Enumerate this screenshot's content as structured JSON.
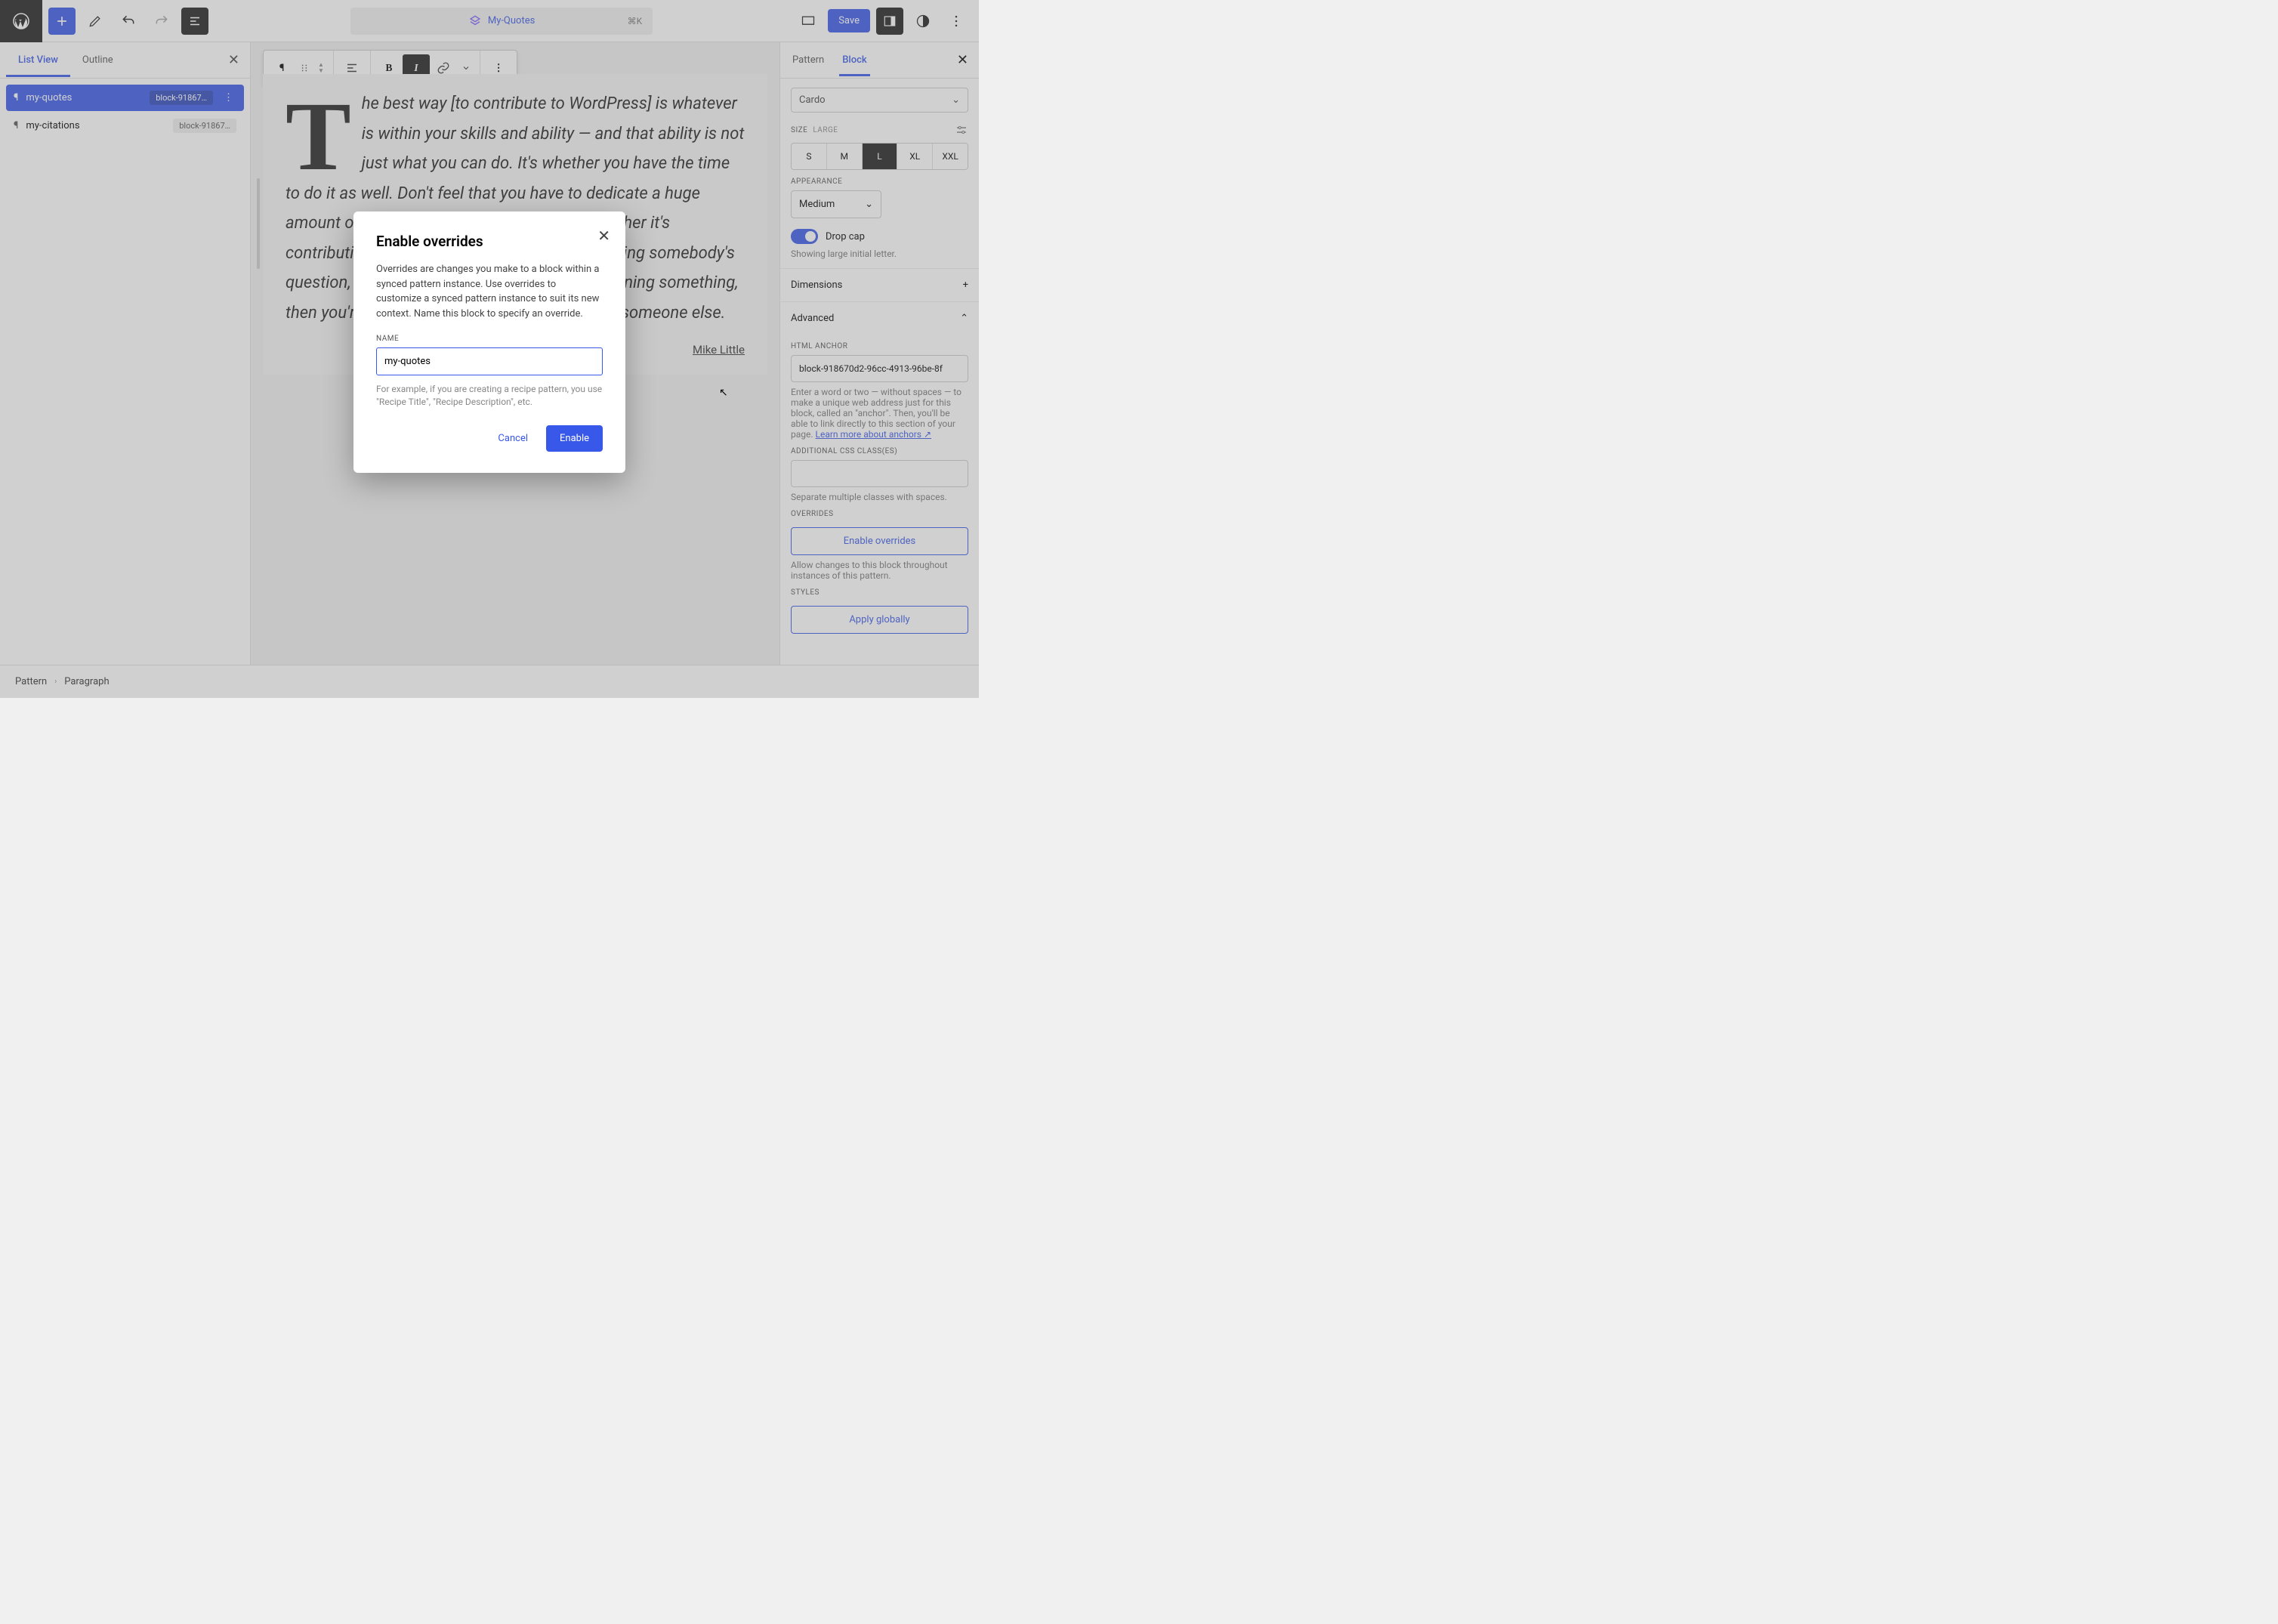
{
  "topbar": {
    "title": "My-Quotes",
    "shortcut": "⌘K",
    "save": "Save"
  },
  "leftPanel": {
    "tabs": {
      "listView": "List View",
      "outline": "Outline"
    },
    "items": [
      {
        "name": "my-quotes",
        "anchor": "block-91867…"
      },
      {
        "name": "my-citations",
        "anchor": "block-91867…"
      }
    ]
  },
  "content": {
    "dropCap": "T",
    "body": "he best way [to contribute to WordPress] is whatever is within your skills and ability — and that ability is not just what you can do. It's whether you have the time to do it as well. Don't feel that you have to dedicate a huge amount of time. Anything that you can do, whether it's contributing on the support forums and answering somebody's question, turning up at a meetup group and learning something, then you're able to take the opportunity to help someone else.",
    "citation": "Mike Little"
  },
  "rightPanel": {
    "tabs": {
      "pattern": "Pattern",
      "block": "Block"
    },
    "font": "Cardo",
    "sizeLabel": "SIZE",
    "sizeValue": "LARGE",
    "sizes": [
      "S",
      "M",
      "L",
      "XL",
      "XXL"
    ],
    "appearanceLabel": "APPEARANCE",
    "appearance": "Medium",
    "dropCap": "Drop cap",
    "dropCapHelp": "Showing large initial letter.",
    "dimensions": "Dimensions",
    "advanced": "Advanced",
    "htmlAnchorLabel": "HTML ANCHOR",
    "htmlAnchor": "block-918670d2-96cc-4913-96be-8f",
    "anchorHelp": "Enter a word or two — without spaces — to make a unique web address just for this block, called an \"anchor\". Then, you'll be able to link directly to this section of your page. ",
    "anchorLink": "Learn more about anchors ↗",
    "cssLabel": "ADDITIONAL CSS CLASS(ES)",
    "cssHelp": "Separate multiple classes with spaces.",
    "overridesLabel": "OVERRIDES",
    "enableOverrides": "Enable overrides",
    "overridesHelp": "Allow changes to this block throughout instances of this pattern.",
    "stylesLabel": "STYLES",
    "applyGlobally": "Apply globally"
  },
  "footer": {
    "crumb1": "Pattern",
    "crumb2": "Paragraph"
  },
  "modal": {
    "title": "Enable overrides",
    "description": "Overrides are changes you make to a block within a synced pattern instance. Use overrides to customize a synced pattern instance to suit its new context. Name this block to specify an override.",
    "nameLabel": "NAME",
    "nameValue": "my-quotes",
    "hint": "For example, if you are creating a recipe pattern, you use \"Recipe Title\", \"Recipe Description\", etc.",
    "cancel": "Cancel",
    "enable": "Enable"
  }
}
